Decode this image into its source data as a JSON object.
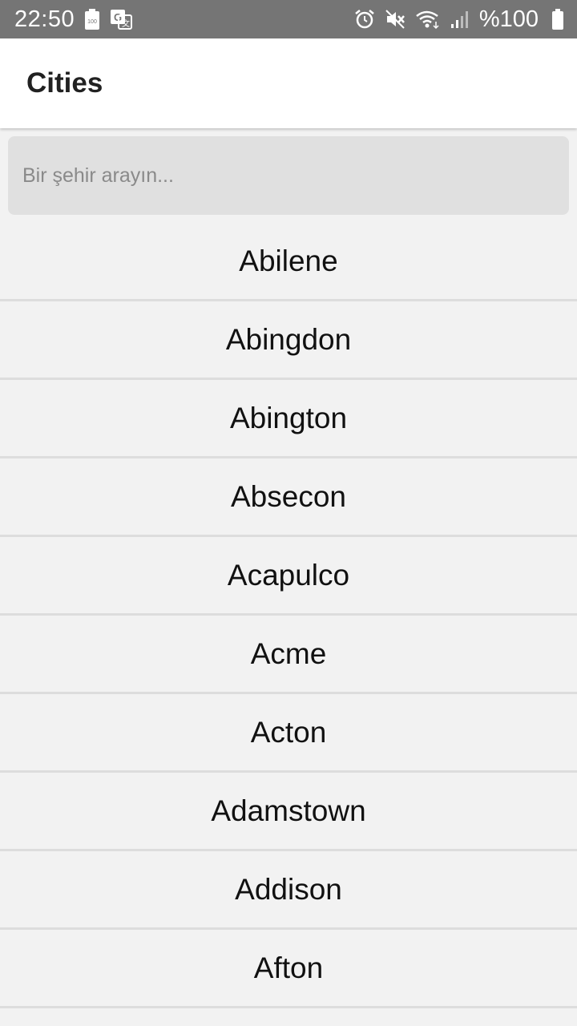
{
  "status_bar": {
    "time": "22:50",
    "battery_text": "%100",
    "icons_left": [
      "battery-saver-icon",
      "translate-icon"
    ],
    "icons_right": [
      "alarm-icon",
      "mute-icon",
      "wifi-icon",
      "signal-icon",
      "battery-icon"
    ]
  },
  "app_bar": {
    "title": "Cities"
  },
  "search": {
    "placeholder": "Bir şehir arayın...",
    "value": ""
  },
  "cities": [
    "Abilene",
    "Abingdon",
    "Abington",
    "Absecon",
    "Acapulco",
    "Acme",
    "Acton",
    "Adamstown",
    "Addison",
    "Afton"
  ],
  "colors": {
    "status_bar_bg": "#757575",
    "app_bar_bg": "#ffffff",
    "search_bg": "#e0e0e0",
    "list_bg": "#f2f2f2",
    "divider": "#dddddd"
  }
}
